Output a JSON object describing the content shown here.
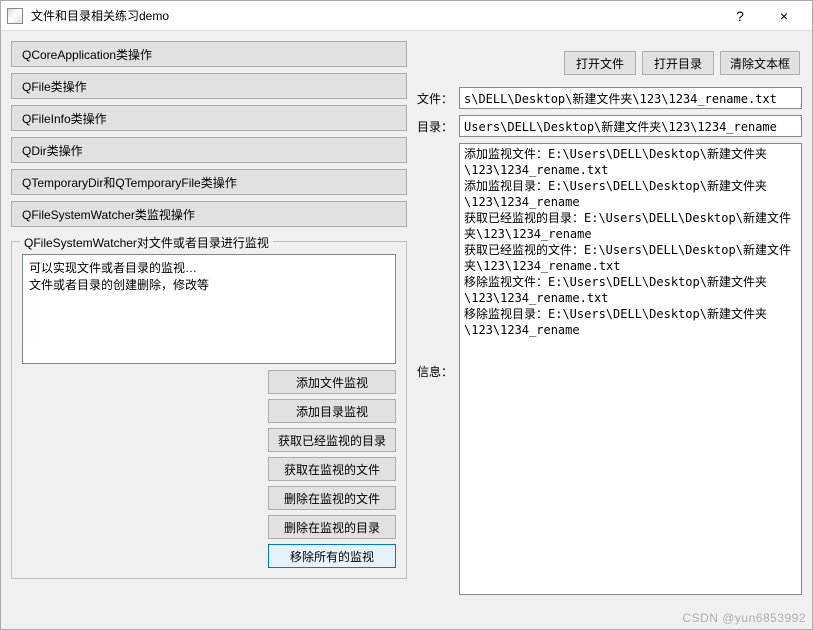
{
  "window": {
    "title": "文件和目录相关练习demo",
    "help": "?",
    "close": "×"
  },
  "left": {
    "buttons": [
      "QCoreApplication类操作",
      "QFile类操作",
      "QFileInfo类操作",
      "QDir类操作",
      "QTemporaryDir和QTemporaryFile类操作",
      "QFileSystemWatcher类监视操作"
    ],
    "group": {
      "title": "QFileSystemWatcher对文件或者目录进行监视",
      "description": "可以实现文件或者目录的监视…\n文件或者目录的创建删除，修改等",
      "buttons": [
        "添加文件监视",
        "添加目录监视",
        "获取已经监视的目录",
        "获取在监视的文件",
        "删除在监视的文件",
        "删除在监视的目录",
        "移除所有的监视"
      ]
    }
  },
  "right": {
    "top_buttons": {
      "open_file": "打开文件",
      "open_dir": "打开目录",
      "clear": "清除文本框"
    },
    "file_label": "文件：",
    "file_value": "s\\DELL\\Desktop\\新建文件夹\\123\\1234_rename.txt",
    "dir_label": "目录：",
    "dir_value": "Users\\DELL\\Desktop\\新建文件夹\\123\\1234_rename",
    "info_label": "信息：",
    "info_text": "添加监视文件：E:\\Users\\DELL\\Desktop\\新建文件夹\\123\\1234_rename.txt\n添加监视目录：E:\\Users\\DELL\\Desktop\\新建文件夹\\123\\1234_rename\n获取已经监视的目录：E:\\Users\\DELL\\Desktop\\新建文件夹\\123\\1234_rename\n获取已经监视的文件：E:\\Users\\DELL\\Desktop\\新建文件夹\\123\\1234_rename.txt\n移除监视文件：E:\\Users\\DELL\\Desktop\\新建文件夹\\123\\1234_rename.txt\n移除监视目录：E:\\Users\\DELL\\Desktop\\新建文件夹\\123\\1234_rename"
  },
  "watermark": "CSDN @yun6853992"
}
